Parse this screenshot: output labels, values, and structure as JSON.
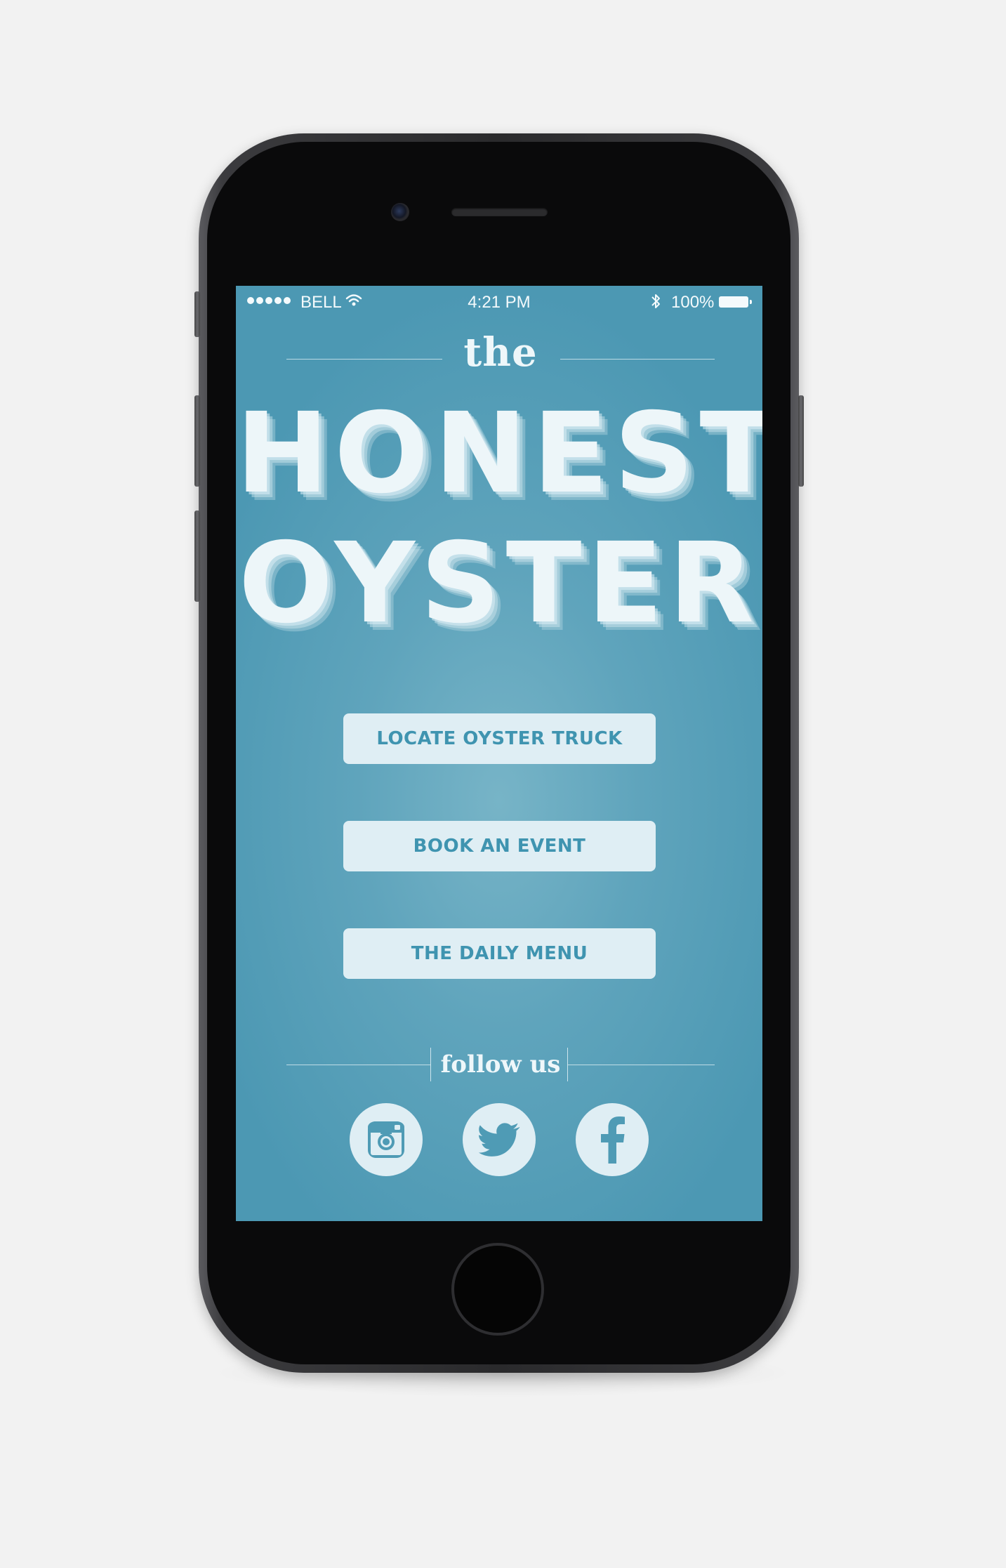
{
  "status_bar": {
    "carrier": "BELL",
    "time": "4:21 PM",
    "battery_pct": "100%",
    "signal_bars": 5,
    "wifi_icon": "wifi-icon",
    "bluetooth_icon": "bluetooth-icon"
  },
  "brand": {
    "article": "the",
    "line1": "HONEST",
    "line2": "OYSTER"
  },
  "menu": {
    "locate_label": "LOCATE OYSTER TRUCK",
    "book_label": "BOOK AN EVENT",
    "menu_label": "THE DAILY MENU"
  },
  "social": {
    "heading": "follow us",
    "icons": [
      "instagram-icon",
      "twitter-icon",
      "facebook-icon"
    ]
  },
  "colors": {
    "screen_bg": "#4c98b3",
    "screen_center": "#77b4c7",
    "button_bg": "#dfeef4",
    "button_text": "#3f94b0",
    "text_light": "#eef7fa"
  }
}
